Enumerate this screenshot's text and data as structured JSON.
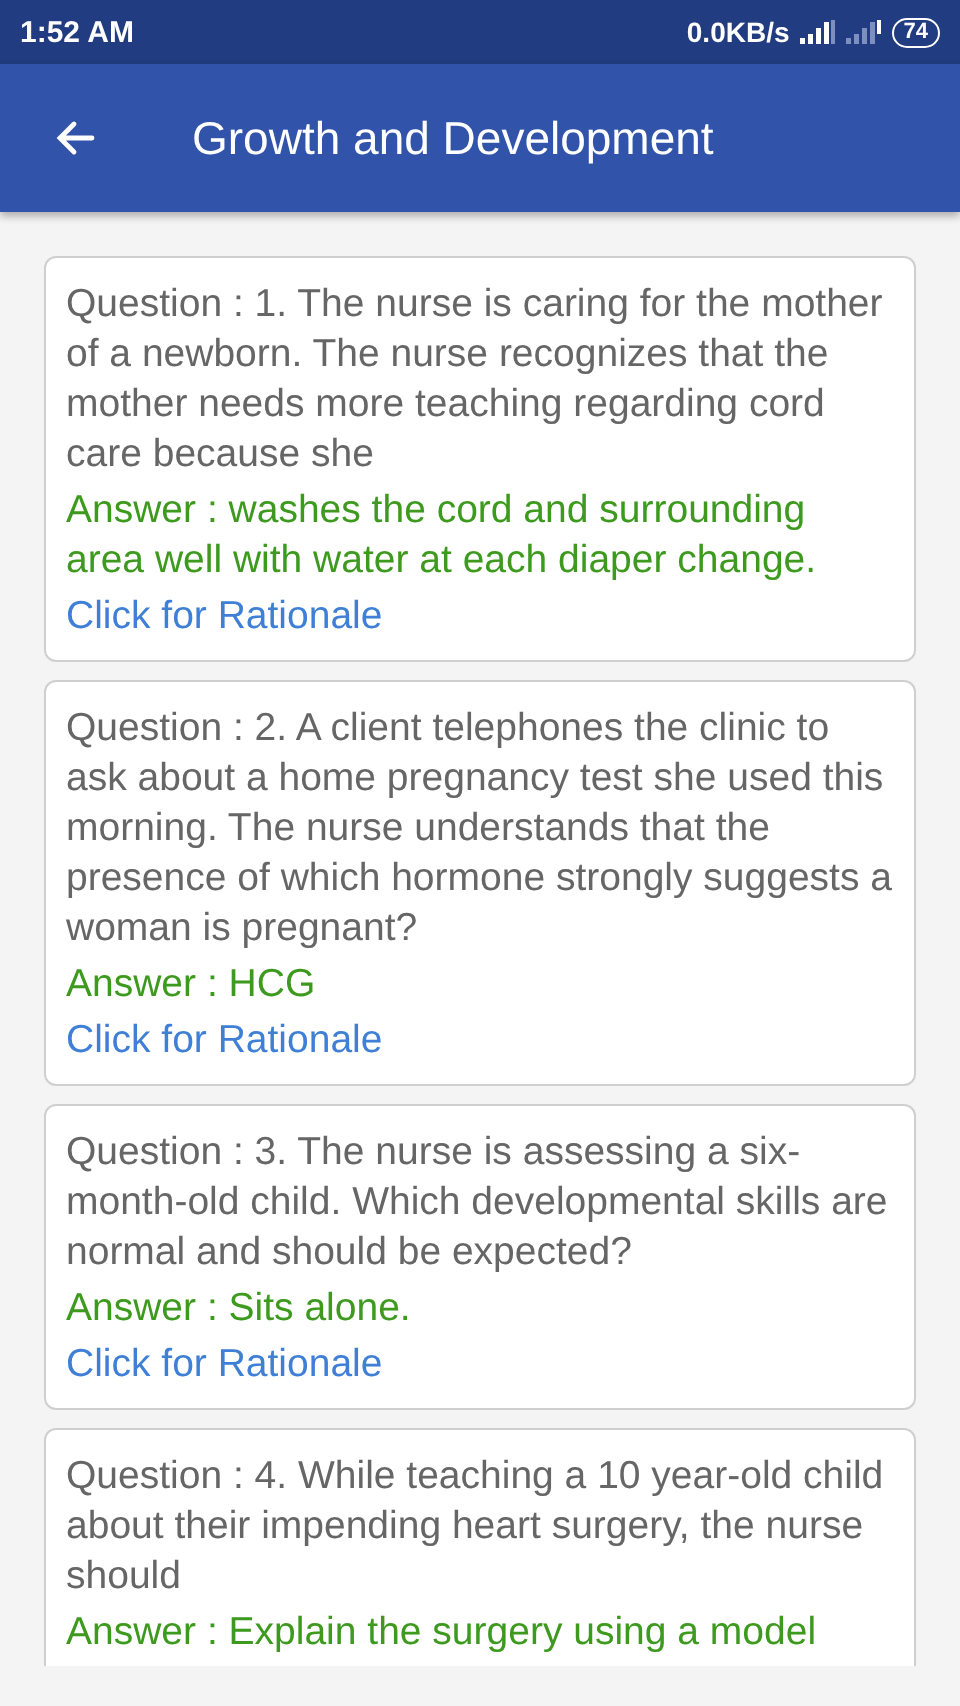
{
  "status_bar": {
    "time": "1:52 AM",
    "network_speed": "0.0KB/s",
    "battery": "74"
  },
  "app_bar": {
    "title": "Growth and Development"
  },
  "questions": [
    {
      "question": "Question : 1. The nurse is caring for the mother of a newborn. The nurse recognizes that the mother needs more teaching regarding cord care because she",
      "answer": "Answer : washes the cord and surrounding area well with water at each diaper change.",
      "link": "Click for Rationale"
    },
    {
      "question": "Question : 2. A client telephones the clinic to ask about a home pregnancy test she used this morning. The nurse understands that the presence of which hormone strongly suggests a woman is pregnant?",
      "answer": "Answer : HCG",
      "link": "Click for Rationale"
    },
    {
      "question": "Question : 3. The nurse is assessing a six-month-old child. Which developmental skills are normal and should be expected?",
      "answer": "Answer : Sits alone.",
      "link": "Click for Rationale"
    },
    {
      "question": "Question : 4. While teaching a 10 year-old child about their impending heart surgery, the nurse should",
      "answer": "Answer : Explain the surgery using a model"
    }
  ]
}
